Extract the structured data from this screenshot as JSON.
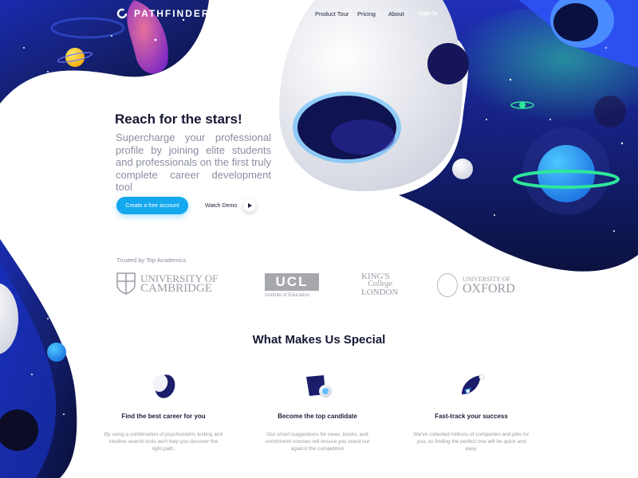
{
  "brand": {
    "name": "PATHFINDER",
    "logo_icon": "ring-logo-icon"
  },
  "nav": {
    "items": [
      "Product Tour",
      "Pricing",
      "About"
    ],
    "signin": "Sign In"
  },
  "hero": {
    "title": "Reach for the stars!",
    "subtitle": "Supercharge your professional profile by joining elite students and professionals on the first truly complete career development tool",
    "cta": "Create a free account",
    "demo": "Watch Demo"
  },
  "trusted": {
    "label": "Trusted by Top Academics",
    "cambridge": [
      "UNIVERSITY OF",
      "CAMBRIDGE"
    ],
    "ucl": {
      "mark": "UCL",
      "sub": "Institute of Education"
    },
    "kings": [
      "KING'S",
      "College",
      "LONDON"
    ],
    "oxford": [
      "UNIVERSITY OF",
      "OXFORD"
    ]
  },
  "section": {
    "title": "What Makes Us Special",
    "features": [
      {
        "title": "Find the best career for you",
        "desc": "By using a combination of psychometric testing and intuitive search tools we'll help you discover the right path.",
        "icon": "capsule-icon"
      },
      {
        "title": "Become the top candidate",
        "desc": "Our smart suggestions for news, books, and enrichment courses will ensure you stand out against the competition",
        "icon": "planet-cube-icon"
      },
      {
        "title": "Fast-track your success",
        "desc": "We've collected millions of companies and jobs for you, so finding the perfect one will be quick and easy.",
        "icon": "rocket-icon"
      }
    ]
  },
  "colors": {
    "accent": "#14a8ee",
    "space_dark": "#0e1550",
    "space_blue": "#2a3fd1"
  }
}
